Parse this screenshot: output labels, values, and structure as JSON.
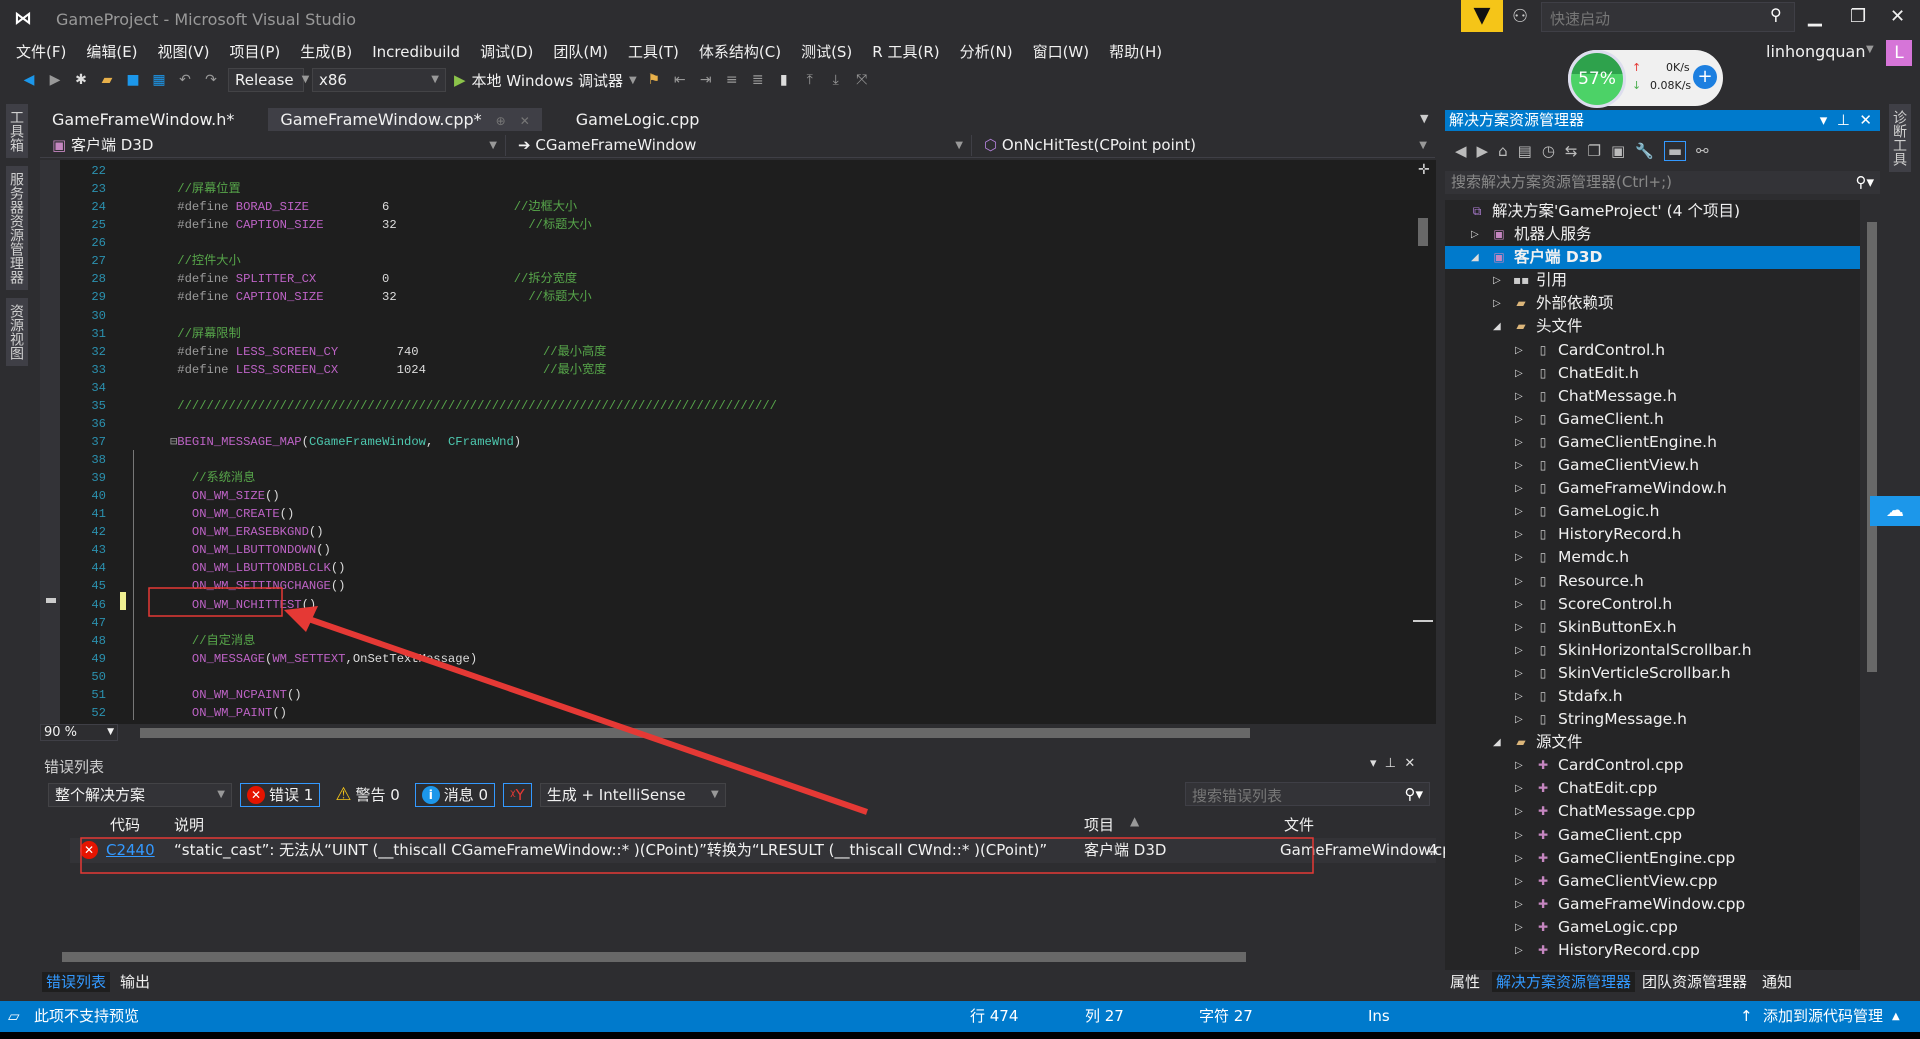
{
  "window": {
    "title": "GameProject - Microsoft Visual Studio",
    "quick_launch_placeholder": "快速启动",
    "user": "linhongquan",
    "avatar_letter": "L"
  },
  "menu": [
    "文件(F)",
    "编辑(E)",
    "视图(V)",
    "项目(P)",
    "生成(B)",
    "Incredibuild",
    "调试(D)",
    "团队(M)",
    "工具(T)",
    "体系结构(C)",
    "测试(S)",
    "R 工具(R)",
    "分析(N)",
    "窗口(W)",
    "帮助(H)"
  ],
  "toolbar": {
    "configuration": "Release",
    "platform": "x86",
    "run_label": "本地 Windows 调试器"
  },
  "net_monitor": {
    "percent": "57%",
    "upload": "0K/s",
    "download": "0.08K/s"
  },
  "left_tabs": [
    "工具箱",
    "服务器资源管理器",
    "资源视图"
  ],
  "right_tabs": [
    "诊断工具"
  ],
  "doc_tabs": [
    {
      "label": "GameFrameWindow.h*"
    },
    {
      "label": "GameFrameWindow.cpp*",
      "active": true
    },
    {
      "label": "GameLogic.cpp"
    }
  ],
  "nav": {
    "project": "客户端 D3D",
    "class": "CGameFrameWindow",
    "member": "OnNcHitTest(CPoint point)"
  },
  "code_lines": [
    {
      "n": "22",
      "tokens": []
    },
    {
      "n": "23",
      "tokens": [
        {
          "t": "    //屏幕位置",
          "c": "comment"
        }
      ]
    },
    {
      "n": "24",
      "tokens": [
        {
          "t": "    #define ",
          "c": "pp"
        },
        {
          "t": "BORAD_SIZE",
          "c": "macro"
        },
        {
          "t": "          6                 ",
          "c": "num"
        },
        {
          "t": "//边框大小",
          "c": "comment"
        }
      ]
    },
    {
      "n": "25",
      "tokens": [
        {
          "t": "    #define ",
          "c": "pp"
        },
        {
          "t": "CAPTION_SIZE",
          "c": "macro"
        },
        {
          "t": "        32                  ",
          "c": "num"
        },
        {
          "t": "//标题大小",
          "c": "comment"
        }
      ]
    },
    {
      "n": "26",
      "tokens": []
    },
    {
      "n": "27",
      "tokens": [
        {
          "t": "    //控件大小",
          "c": "comment"
        }
      ]
    },
    {
      "n": "28",
      "tokens": [
        {
          "t": "    #define ",
          "c": "pp"
        },
        {
          "t": "SPLITTER_CX",
          "c": "macro"
        },
        {
          "t": "         0                 ",
          "c": "num"
        },
        {
          "t": "//拆分宽度",
          "c": "comment"
        }
      ]
    },
    {
      "n": "29",
      "tokens": [
        {
          "t": "    #define ",
          "c": "pp"
        },
        {
          "t": "CAPTION_SIZE",
          "c": "macro"
        },
        {
          "t": "        32                  ",
          "c": "num"
        },
        {
          "t": "//标题大小",
          "c": "comment"
        }
      ]
    },
    {
      "n": "30",
      "tokens": []
    },
    {
      "n": "31",
      "tokens": [
        {
          "t": "    //屏幕限制",
          "c": "comment"
        }
      ]
    },
    {
      "n": "32",
      "tokens": [
        {
          "t": "    #define ",
          "c": "pp"
        },
        {
          "t": "LESS_SCREEN_CY",
          "c": "macro"
        },
        {
          "t": "        740                 ",
          "c": "num"
        },
        {
          "t": "//最小高度",
          "c": "comment"
        }
      ]
    },
    {
      "n": "33",
      "tokens": [
        {
          "t": "    #define ",
          "c": "pp"
        },
        {
          "t": "LESS_SCREEN_CX",
          "c": "macro"
        },
        {
          "t": "        1024                ",
          "c": "num"
        },
        {
          "t": "//最小宽度",
          "c": "comment"
        }
      ]
    },
    {
      "n": "34",
      "tokens": []
    },
    {
      "n": "35",
      "tokens": [
        {
          "t": "    //////////////////////////////////////////////////////////////////////////////////",
          "c": "comment"
        }
      ]
    },
    {
      "n": "36",
      "tokens": []
    },
    {
      "n": "37",
      "tokens": [
        {
          "t": "   ⊟",
          "c": "pp"
        },
        {
          "t": "BEGIN_MESSAGE_MAP",
          "c": "macro"
        },
        {
          "t": "(",
          "c": "plain"
        },
        {
          "t": "CGameFrameWindow",
          "c": "type"
        },
        {
          "t": ",  ",
          "c": "plain"
        },
        {
          "t": "CFrameWnd",
          "c": "type"
        },
        {
          "t": ")",
          "c": "plain"
        }
      ]
    },
    {
      "n": "38",
      "tokens": []
    },
    {
      "n": "39",
      "tokens": [
        {
          "t": "      //系统消息",
          "c": "comment"
        }
      ]
    },
    {
      "n": "40",
      "tokens": [
        {
          "t": "      ",
          "c": "plain"
        },
        {
          "t": "ON_WM_SIZE",
          "c": "macro"
        },
        {
          "t": "()",
          "c": "plain"
        }
      ]
    },
    {
      "n": "41",
      "tokens": [
        {
          "t": "      ",
          "c": "plain"
        },
        {
          "t": "ON_WM_CREATE",
          "c": "macro"
        },
        {
          "t": "()",
          "c": "plain"
        }
      ]
    },
    {
      "n": "42",
      "tokens": [
        {
          "t": "      ",
          "c": "plain"
        },
        {
          "t": "ON_WM_ERASEBKGND",
          "c": "macro"
        },
        {
          "t": "()",
          "c": "plain"
        }
      ]
    },
    {
      "n": "43",
      "tokens": [
        {
          "t": "      ",
          "c": "plain"
        },
        {
          "t": "ON_WM_LBUTTONDOWN",
          "c": "macro"
        },
        {
          "t": "()",
          "c": "plain"
        }
      ]
    },
    {
      "n": "44",
      "tokens": [
        {
          "t": "      ",
          "c": "plain"
        },
        {
          "t": "ON_WM_LBUTTONDBLCLK",
          "c": "macro"
        },
        {
          "t": "()",
          "c": "plain"
        }
      ]
    },
    {
      "n": "45",
      "tokens": [
        {
          "t": "      ",
          "c": "plain"
        },
        {
          "t": "ON_WM_SETTINGCHANGE",
          "c": "macro"
        },
        {
          "t": "()",
          "c": "plain"
        }
      ]
    },
    {
      "n": "46",
      "tokens": [
        {
          "t": "      ",
          "c": "plain"
        },
        {
          "t": "ON_WM_NCHITTEST",
          "c": "macro"
        },
        {
          "t": "()",
          "c": "plain"
        }
      ]
    },
    {
      "n": "47",
      "tokens": []
    },
    {
      "n": "48",
      "tokens": [
        {
          "t": "      //自定消息",
          "c": "comment"
        }
      ]
    },
    {
      "n": "49",
      "tokens": [
        {
          "t": "      ",
          "c": "plain"
        },
        {
          "t": "ON_MESSAGE",
          "c": "macro"
        },
        {
          "t": "(",
          "c": "plain"
        },
        {
          "t": "WM_SETTEXT",
          "c": "macro"
        },
        {
          "t": ",OnSetTextMessage)",
          "c": "plain"
        }
      ]
    },
    {
      "n": "50",
      "tokens": []
    },
    {
      "n": "51",
      "tokens": [
        {
          "t": "      ",
          "c": "plain"
        },
        {
          "t": "ON_WM_NCPAINT",
          "c": "macro"
        },
        {
          "t": "()",
          "c": "plain"
        }
      ]
    },
    {
      "n": "52",
      "tokens": [
        {
          "t": "      ",
          "c": "plain"
        },
        {
          "t": "ON_WM_PAINT",
          "c": "macro"
        },
        {
          "t": "()",
          "c": "plain"
        }
      ]
    }
  ],
  "editor": {
    "zoom": "90 %"
  },
  "error_list": {
    "title": "错误列表",
    "scope": "整个解决方案",
    "errors": "错误 1",
    "warnings": "警告 0",
    "messages": "消息 0",
    "source": "生成 + IntelliSense",
    "search_placeholder": "搜索错误列表",
    "columns": [
      "代码",
      "说明",
      "项目",
      "文件"
    ],
    "rows": [
      {
        "code": "C2440",
        "description": "“static_cast”: 无法从“UINT (__thiscall CGameFrameWindow::* )(CPoint)”转换为“LRESULT (__thiscall CWnd::* )(CPoint)”",
        "project": "客户端 D3D",
        "file": "GameFrameWindow.cpp",
        "line": "4"
      }
    ]
  },
  "bottom_tabs": [
    "错误列表",
    "输出"
  ],
  "solution_explorer": {
    "title": "解决方案资源管理器",
    "search_placeholder": "搜索解决方案资源管理器(Ctrl+;)",
    "items": [
      {
        "label": "解决方案'GameProject' (4 个项目)",
        "level": 0,
        "icon": "solution"
      },
      {
        "label": "机器人服务",
        "level": 1,
        "icon": "project",
        "exp": "collapsed"
      },
      {
        "label": "客户端 D3D",
        "level": 1,
        "icon": "project",
        "exp": "expanded",
        "selected": true
      },
      {
        "label": "引用",
        "level": 2,
        "icon": "references",
        "exp": "collapsed"
      },
      {
        "label": "外部依赖项",
        "level": 2,
        "icon": "folder",
        "exp": "collapsed"
      },
      {
        "label": "头文件",
        "level": 2,
        "icon": "folder",
        "exp": "expanded"
      },
      {
        "label": "CardControl.h",
        "level": 3,
        "icon": "header",
        "exp": "collapsed"
      },
      {
        "label": "ChatEdit.h",
        "level": 3,
        "icon": "header",
        "exp": "collapsed"
      },
      {
        "label": "ChatMessage.h",
        "level": 3,
        "icon": "header",
        "exp": "collapsed"
      },
      {
        "label": "GameClient.h",
        "level": 3,
        "icon": "header",
        "exp": "collapsed"
      },
      {
        "label": "GameClientEngine.h",
        "level": 3,
        "icon": "header",
        "exp": "collapsed"
      },
      {
        "label": "GameClientView.h",
        "level": 3,
        "icon": "header",
        "exp": "collapsed"
      },
      {
        "label": "GameFrameWindow.h",
        "level": 3,
        "icon": "header",
        "exp": "collapsed"
      },
      {
        "label": "GameLogic.h",
        "level": 3,
        "icon": "header",
        "exp": "collapsed"
      },
      {
        "label": "HistoryRecord.h",
        "level": 3,
        "icon": "header",
        "exp": "collapsed"
      },
      {
        "label": "Memdc.h",
        "level": 3,
        "icon": "header",
        "exp": "collapsed"
      },
      {
        "label": "Resource.h",
        "level": 3,
        "icon": "header",
        "exp": "collapsed"
      },
      {
        "label": "ScoreControl.h",
        "level": 3,
        "icon": "header",
        "exp": "collapsed"
      },
      {
        "label": "SkinButtonEx.h",
        "level": 3,
        "icon": "header",
        "exp": "collapsed"
      },
      {
        "label": "SkinHorizontalScrollbar.h",
        "level": 3,
        "icon": "header",
        "exp": "collapsed"
      },
      {
        "label": "SkinVerticleScrollbar.h",
        "level": 3,
        "icon": "header",
        "exp": "collapsed"
      },
      {
        "label": "Stdafx.h",
        "level": 3,
        "icon": "header",
        "exp": "collapsed"
      },
      {
        "label": "StringMessage.h",
        "level": 3,
        "icon": "header",
        "exp": "collapsed"
      },
      {
        "label": "源文件",
        "level": 2,
        "icon": "folder",
        "exp": "expanded"
      },
      {
        "label": "CardControl.cpp",
        "level": 3,
        "icon": "cpp",
        "exp": "collapsed"
      },
      {
        "label": "ChatEdit.cpp",
        "level": 3,
        "icon": "cpp",
        "exp": "collapsed"
      },
      {
        "label": "ChatMessage.cpp",
        "level": 3,
        "icon": "cpp",
        "exp": "collapsed"
      },
      {
        "label": "GameClient.cpp",
        "level": 3,
        "icon": "cpp",
        "exp": "collapsed"
      },
      {
        "label": "GameClientEngine.cpp",
        "level": 3,
        "icon": "cpp",
        "exp": "collapsed"
      },
      {
        "label": "GameClientView.cpp",
        "level": 3,
        "icon": "cpp",
        "exp": "collapsed"
      },
      {
        "label": "GameFrameWindow.cpp",
        "level": 3,
        "icon": "cpp",
        "exp": "collapsed"
      },
      {
        "label": "GameLogic.cpp",
        "level": 3,
        "icon": "cpp",
        "exp": "collapsed"
      },
      {
        "label": "HistoryRecord.cpp",
        "level": 3,
        "icon": "cpp",
        "exp": "collapsed"
      }
    ],
    "bottom_tabs": [
      "属性",
      "解决方案资源管理器",
      "团队资源管理器",
      "通知"
    ]
  },
  "status": {
    "message": "此项不支持预览",
    "line": "行 474",
    "col": "列 27",
    "char": "字符 27",
    "mode": "Ins",
    "source_control": "添加到源代码管理"
  },
  "colors": {
    "accent": "#007acc",
    "annotation": "#e53935",
    "error": "#e51400"
  }
}
